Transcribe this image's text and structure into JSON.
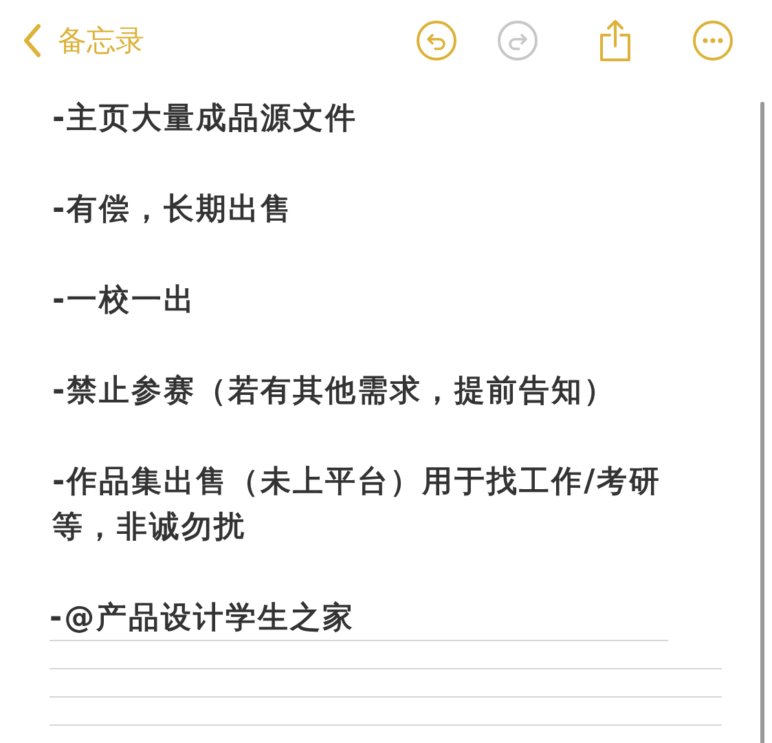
{
  "nav": {
    "back_label": "备忘录",
    "undo": {
      "disabled": false
    },
    "redo": {
      "disabled": true
    }
  },
  "note": {
    "paragraphs": [
      "-主页大量成品源文件",
      "-有偿，长期出售",
      "-一校一出",
      "-禁止参赛（若有其他需求，提前告知）",
      "-作品集出售（未上平台）用于找工作/考研等，非诚勿扰",
      "-@产品设计学生之家"
    ]
  }
}
